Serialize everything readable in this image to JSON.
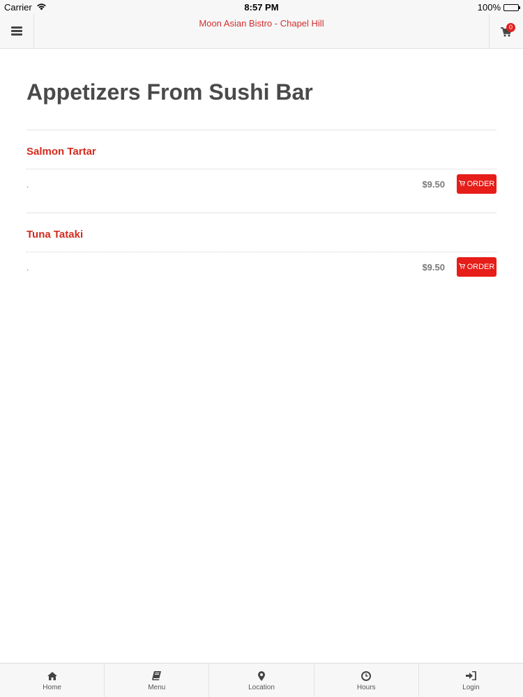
{
  "status_bar": {
    "carrier": "Carrier",
    "time": "8:57 PM",
    "battery": "100%"
  },
  "nav": {
    "title": "Moon Asian Bistro - Chapel Hill",
    "cart_count": "0"
  },
  "page": {
    "title": "Appetizers From Sushi Bar"
  },
  "items": [
    {
      "name": "Salmon Tartar",
      "description": ".",
      "price": "$9.50",
      "order_label": "ORDER"
    },
    {
      "name": "Tuna Tataki",
      "description": ".",
      "price": "$9.50",
      "order_label": "ORDER"
    }
  ],
  "tabs": [
    {
      "label": "Home",
      "icon": "home-icon"
    },
    {
      "label": "Menu",
      "icon": "book-icon"
    },
    {
      "label": "Location",
      "icon": "map-marker-icon"
    },
    {
      "label": "Hours",
      "icon": "clock-icon"
    },
    {
      "label": "Login",
      "icon": "sign-in-icon"
    }
  ],
  "colors": {
    "accent": "#d42a1e",
    "button": "#e61d18",
    "title": "#4a4a4a"
  }
}
